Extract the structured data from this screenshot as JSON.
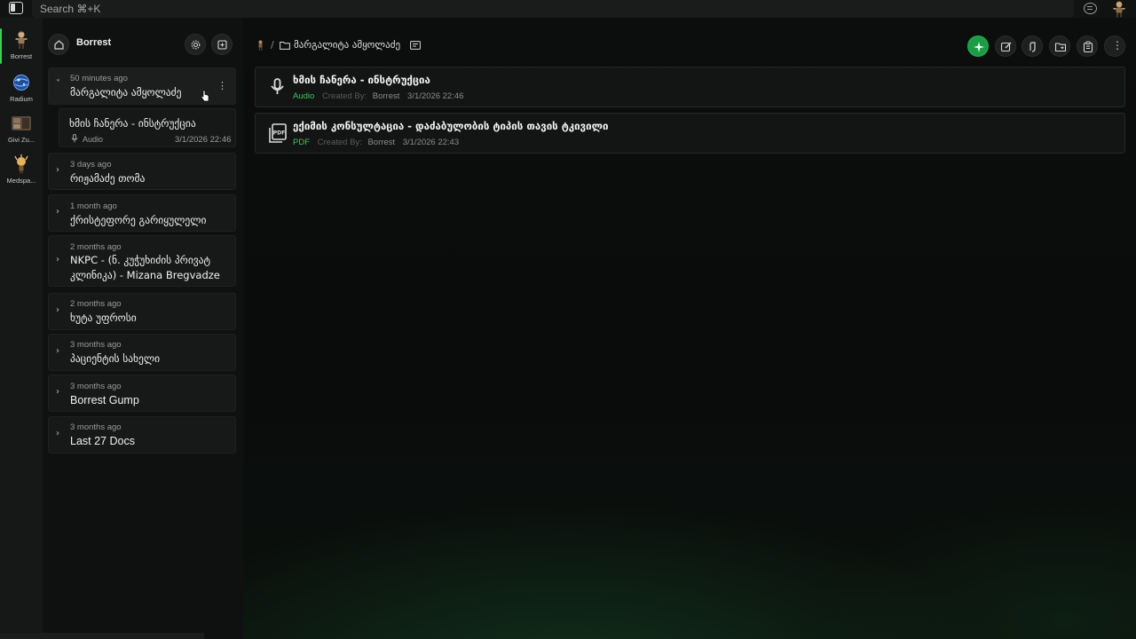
{
  "topbar": {
    "search_placeholder": "Search ⌘+K"
  },
  "rail": {
    "workspaces": [
      {
        "label": "Borrest",
        "icon": "character-avatar-icon",
        "active": true
      },
      {
        "label": "Radium",
        "icon": "radium-globe-icon",
        "active": false
      },
      {
        "label": "Givi Zu...",
        "icon": "givi-photo-icon",
        "active": false
      },
      {
        "label": "Medspa...",
        "icon": "medspa-avatar-icon",
        "active": false
      }
    ]
  },
  "sidebar": {
    "title": "Borrest",
    "documents": [
      {
        "when": "50 minutes ago",
        "name": "მარგალიტა ამყოლაძე",
        "expanded": true
      },
      {
        "when": "3 days ago",
        "name": "რიჟამაძე თომა"
      },
      {
        "when": "1 month ago",
        "name": "ქრისტეფორე გარიყულელი"
      },
      {
        "when": "2 months ago",
        "name": "NKPC - (ნ. კუჭუხიძის პრივატ კლინიკა) - Mizana Bregvadze"
      },
      {
        "when": "2 months ago",
        "name": "ხუტა უფროსი"
      },
      {
        "when": "3 months ago",
        "name": "პაციენტის სახელი"
      },
      {
        "when": "3 months ago",
        "name": "Borrest Gump"
      },
      {
        "when": "3 months ago",
        "name": "Last 27 Docs"
      }
    ],
    "expanded_child": {
      "title": "ხმის ჩანერა - ინსტრუქცია",
      "type": "Audio",
      "date": "3/1/2026 22:46"
    }
  },
  "main": {
    "breadcrumb": {
      "separator": "/",
      "folder_name": "მარგალიტა ამყოლაძე"
    },
    "files": [
      {
        "title": "ხმის ჩანერა - ინსტრუქცია",
        "type": "Audio",
        "created_by_label": "Created By:",
        "created_by": "Borrest",
        "date": "3/1/2026 22:46",
        "icon": "microphone-icon"
      },
      {
        "title": "ექიმის კონსულტაცია - დაძაბულობის ტიპის თავის ტკივილი",
        "type": "PDF",
        "created_by_label": "Created By:",
        "created_by": "Borrest",
        "date": "3/1/2026 22:43",
        "icon": "pdf-icon"
      }
    ]
  },
  "colors": {
    "accent_green": "#1e9c45",
    "type_green": "#3ec45f",
    "background": "#0b0c0c"
  }
}
